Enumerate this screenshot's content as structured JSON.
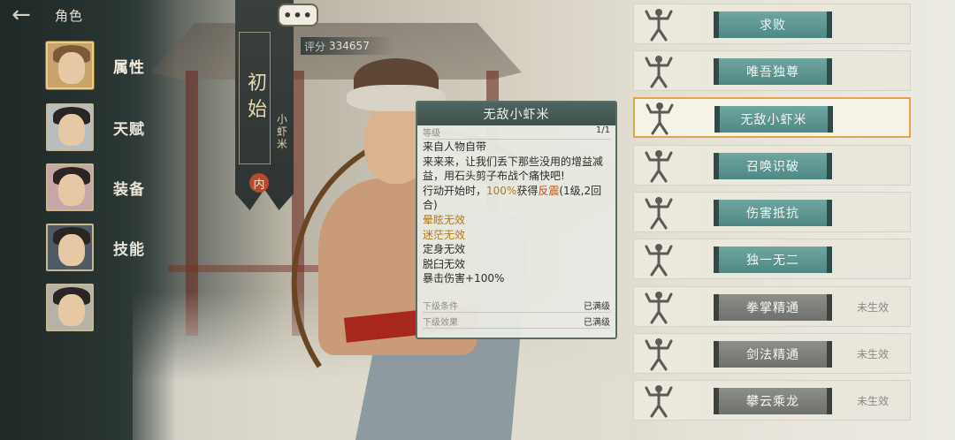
{
  "header": {
    "back_icon": "arrow-left-icon",
    "title": "角色"
  },
  "nav": [
    {
      "label": "属性",
      "icon": "portrait-hat-man",
      "active": true
    },
    {
      "label": "天赋",
      "icon": "portrait-young-man"
    },
    {
      "label": "装备",
      "icon": "portrait-woman-flowers"
    },
    {
      "label": "技能",
      "icon": "portrait-sword-man"
    },
    {
      "label": "",
      "icon": "portrait-woman"
    }
  ],
  "banner": {
    "rank": "初始",
    "name": "小虾米",
    "seal": "内"
  },
  "more_button": "•••",
  "score": {
    "label": "评分",
    "value": "334657"
  },
  "tooltip": {
    "title": "无敌小虾米",
    "level_label": "等级",
    "level_value": "1/1",
    "source": "来自人物自带",
    "desc": "来来来，让我们丢下那些没用的增益减益，用石头剪子布战个痛快吧!",
    "effect_prefix": "行动开始时，",
    "effect_pct": "100%",
    "effect_mid": "获得",
    "effect_buff": "反震",
    "effect_suffix": "(1级,2回合)",
    "immunities": [
      "晕眩无效",
      "迷茫无效",
      "定身无效",
      "脱臼无效"
    ],
    "crit_label": "暴击伤害",
    "crit_value": "+100%",
    "next_cond_label": "下级条件",
    "next_cond_value": "已满级",
    "next_effect_label": "下级效果",
    "next_effect_value": "已满级"
  },
  "skills": [
    {
      "name": "求败",
      "active": true,
      "status": ""
    },
    {
      "name": "唯吾独尊",
      "active": true,
      "status": ""
    },
    {
      "name": "无敌小虾米",
      "active": true,
      "status": "",
      "selected": true
    },
    {
      "name": "召唤识破",
      "active": true,
      "status": ""
    },
    {
      "name": "伤害抵抗",
      "active": true,
      "status": ""
    },
    {
      "name": "独一无二",
      "active": true,
      "status": ""
    },
    {
      "name": "拳掌精通",
      "active": false,
      "status": "未生效"
    },
    {
      "name": "剑法精通",
      "active": false,
      "status": "未生效"
    },
    {
      "name": "攀云乘龙",
      "active": false,
      "status": "未生效"
    }
  ],
  "colors": {
    "active_btn": "#5f9792",
    "inactive_btn": "#7e807b",
    "selected_border": "#e3a54a",
    "highlight_text": "#c0551a"
  }
}
